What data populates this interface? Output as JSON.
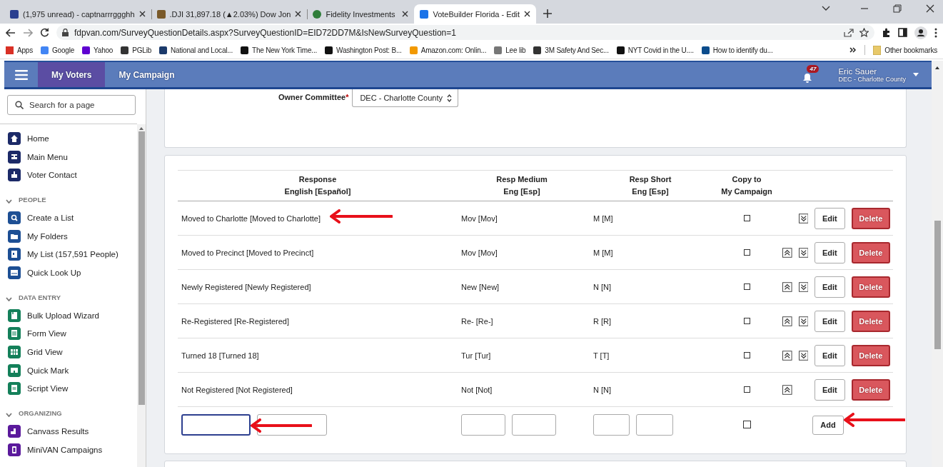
{
  "browser": {
    "tabs": [
      {
        "title": "(1,975 unread) - captnarrrggghh",
        "selected": false
      },
      {
        "title": ".DJI 31,897.18 (▲2.03%) Dow Jon",
        "selected": false
      },
      {
        "title": "Fidelity Investments",
        "selected": false
      },
      {
        "title": "VoteBuilder Florida - Edit",
        "selected": true
      }
    ],
    "url": "fdpvan.com/SurveyQuestionDetails.aspx?SurveyQuestionID=EID72DD7M&IsNewSurveyQuestion=1",
    "bookmarks": [
      "Apps",
      "Google",
      "Yahoo",
      "PGLib",
      "National and Local...",
      "The New York Time...",
      "Washington Post: B...",
      "Amazon.com: Onlin...",
      "Lee lib",
      "3M Safety And Sec...",
      "NYT Covid in the U....",
      "How to identify du..."
    ],
    "other_bookmarks": "Other bookmarks"
  },
  "navbar": {
    "tabs": [
      {
        "label": "My Voters",
        "selected": true
      },
      {
        "label": "My Campaign",
        "selected": false
      }
    ],
    "notification_count": "47",
    "user": {
      "name": "Eric Sauer",
      "committee": "DEC - Charlotte County"
    }
  },
  "sidebar": {
    "search": {
      "placeholder": "Search for a page"
    },
    "sections": [
      {
        "color": "#1c2a68",
        "items": [
          "Home",
          "Main Menu",
          "Voter Contact"
        ]
      },
      {
        "title": "PEOPLE",
        "color": "#1d4f94",
        "items": [
          "Create a List",
          "My Folders",
          "My List (157,591 People)",
          "Quick Look Up"
        ]
      },
      {
        "title": "DATA ENTRY",
        "color": "#14805a",
        "items": [
          "Bulk Upload Wizard",
          "Form View",
          "Grid View",
          "Quick Mark",
          "Script View"
        ]
      },
      {
        "title": "ORGANIZING",
        "color": "#5b1a9c",
        "items": [
          "Canvass Results",
          "MiniVAN Campaigns"
        ]
      }
    ]
  },
  "owner_committee": {
    "label": "Owner Committee",
    "required_mark": "*",
    "value": "DEC - Charlotte County"
  },
  "responses": {
    "columns": [
      {
        "label": "Response",
        "sublabel": "English [Español]"
      },
      {
        "label": "Resp Medium",
        "sublabel": "Eng [Esp]"
      },
      {
        "label": "Resp Short",
        "sublabel": "Eng [Esp]"
      },
      {
        "label": "Copy to",
        "sublabel": "My Campaign"
      }
    ],
    "rows": [
      {
        "response": "Moved to Charlotte [Moved to Charlotte]",
        "medium": "Mov [Mov]",
        "short": "M [M]",
        "copy": false,
        "can_move_up": false,
        "can_move_down": true,
        "edit": "Edit",
        "delete": "Delete"
      },
      {
        "response": "Moved to Precinct [Moved to Precinct]",
        "medium": "Mov [Mov]",
        "short": "M [M]",
        "copy": false,
        "can_move_up": true,
        "can_move_down": true,
        "edit": "Edit",
        "delete": "Delete"
      },
      {
        "response": "Newly Registered [Newly Registered]",
        "medium": "New [New]",
        "short": "N [N]",
        "copy": false,
        "can_move_up": true,
        "can_move_down": true,
        "edit": "Edit",
        "delete": "Delete"
      },
      {
        "response": "Re-Registered [Re-Registered]",
        "medium": "Re- [Re-]",
        "short": "R [R]",
        "copy": false,
        "can_move_up": true,
        "can_move_down": true,
        "edit": "Edit",
        "delete": "Delete"
      },
      {
        "response": "Turned 18 [Turned 18]",
        "medium": "Tur [Tur]",
        "short": "T [T]",
        "copy": false,
        "can_move_up": true,
        "can_move_down": true,
        "edit": "Edit",
        "delete": "Delete"
      },
      {
        "response": "Not Registered [Not Registered]",
        "medium": "Not [Not]",
        "short": "N [N]",
        "copy": false,
        "can_move_up": true,
        "can_move_down": false,
        "edit": "Edit",
        "delete": "Delete"
      }
    ],
    "new_row": {
      "inputs": [
        {
          "focused": true
        },
        {
          "focused": false
        },
        {
          "focused": false
        },
        {
          "focused": false
        },
        {
          "focused": false
        },
        {
          "focused": false
        }
      ],
      "copy": false,
      "add": "Add"
    }
  }
}
